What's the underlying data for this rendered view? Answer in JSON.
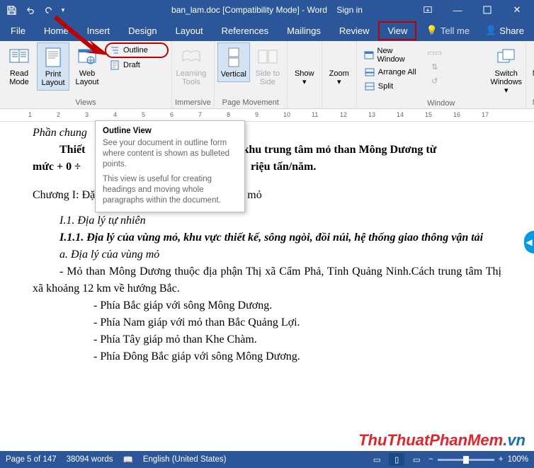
{
  "window": {
    "title": "ban_lam.doc [Compatibility Mode] - Word",
    "signin": "Sign in"
  },
  "qat": {
    "save": "💾",
    "undo": "↶",
    "redo": "↷",
    "more": "▾"
  },
  "tabs": [
    "File",
    "Home",
    "Insert",
    "Design",
    "Layout",
    "References",
    "Mailings",
    "Review",
    "View"
  ],
  "active_tab_index": 8,
  "tellme": "Tell me",
  "share": "Share",
  "ribbon": {
    "views": {
      "label": "Views",
      "read_mode": "Read Mode",
      "print_layout": "Print Layout",
      "web_layout": "Web Layout",
      "outline": "Outline",
      "draft": "Draft"
    },
    "immersive": {
      "label": "Immersive",
      "learning_tools": "Learning Tools"
    },
    "page_movement": {
      "label": "Page Movement",
      "vertical": "Vertical",
      "side": "Side to Side"
    },
    "show": "Show",
    "zoom": "Zoom",
    "window": {
      "label": "Window",
      "new_window": "New Window",
      "arrange_all": "Arrange All",
      "split": "Split",
      "switch_windows": "Switch Windows"
    },
    "macros": {
      "label": "Macros",
      "macros": "Macros"
    }
  },
  "ruler_marks": [
    "1",
    "2",
    "3",
    "4",
    "5",
    "6",
    "7",
    "8",
    "9",
    "10",
    "11",
    "12",
    "13",
    "14",
    "15",
    "16",
    "17"
  ],
  "tooltip": {
    "title": "Outline View",
    "body1": "See your document in outline form where content is shown as bulleted points.",
    "body2": "This view is useful for creating headings and moving whole paragraphs within the document."
  },
  "document": {
    "phan_chung": "Phần chung",
    "thiet": "Thiết",
    "thiet_tail": "khu trung tâm mỏ than Mông Dương từ",
    "muc_prefix": "mức + 0 ÷",
    "muc_suffix": "riệu tấn/năm.",
    "chuong1": "Chương I: Đặc Điểm và điều kiện địa chất khu mỏ",
    "i1": "I.1. Địa lý tự  nhiên",
    "i11": "I.1.1. Địa lý của vùng mỏ, khu vực thiết kế, sông ngòi, đồi núi, hệ thống giao thông vận tải",
    "a": "a. Địa lý của vùng mỏ",
    "p1": "- Mỏ than Mông Dương thuộc địa phận Thị xã Cẩm Phả, Tỉnh Quảng Ninh.Cách trung tâm Thị xã khoảng 12 km về hướng Bắc.",
    "p2": "- Phía Bắc giáp với sông Mông Dương.",
    "p3": "- Phía Nam giáp với mỏ than Bắc Quảng Lợi.",
    "p4": "- Phía Tây giáp mỏ than Khe Chàm.",
    "p5": "- Phía Đông Bắc giáp với sông Mông Dương."
  },
  "watermark": {
    "part1": "ThuThuatPhanMem",
    "part2": ".vn"
  },
  "status": {
    "page": "Page 5 of 147",
    "words": "38094 words",
    "lang": "English (United States)",
    "zoom": "100%"
  }
}
